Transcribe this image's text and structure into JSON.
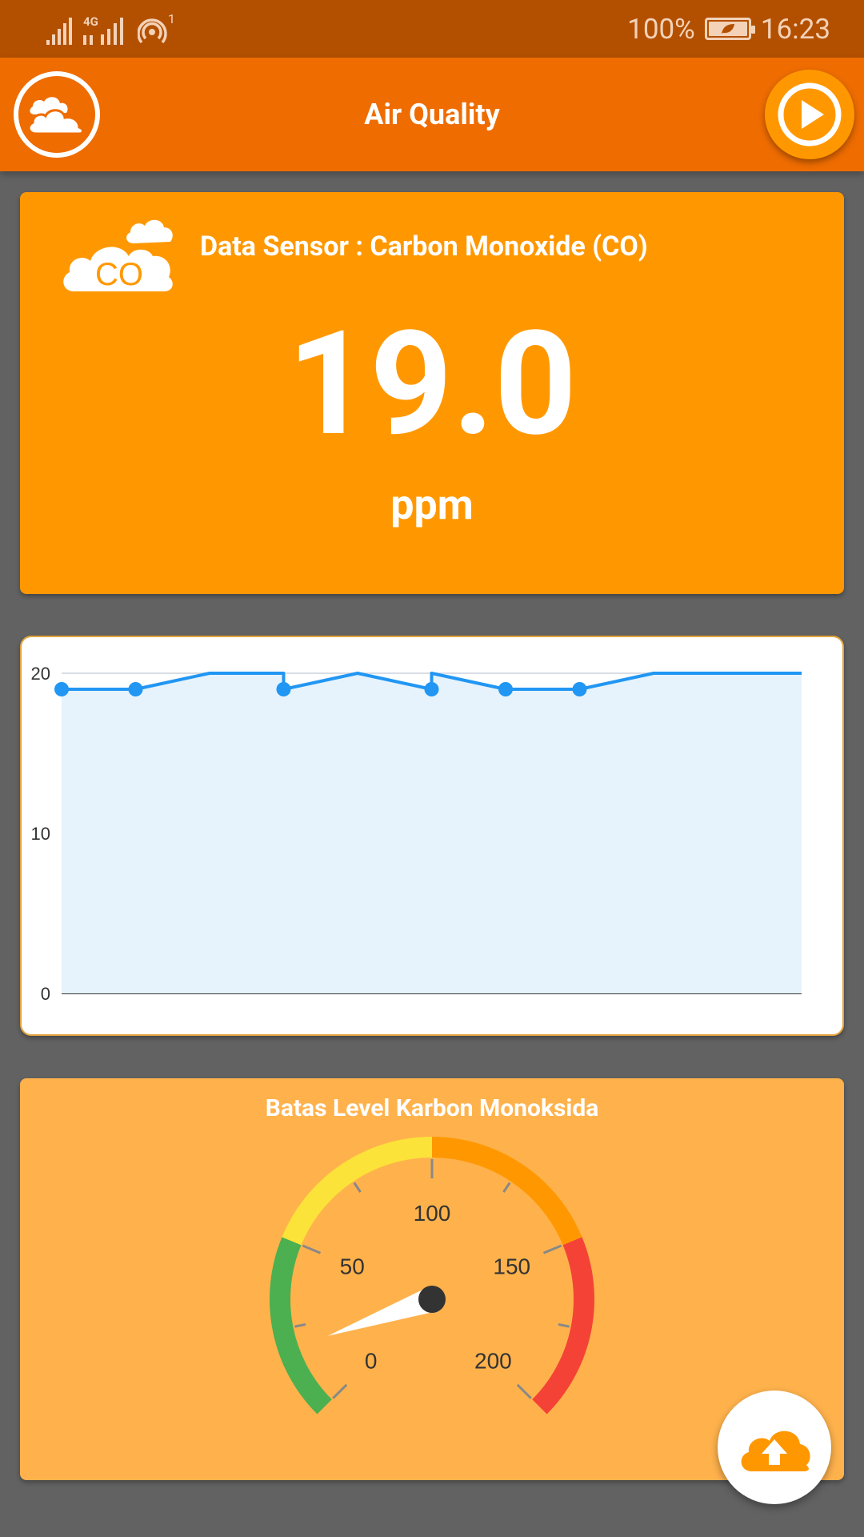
{
  "status_bar": {
    "network": "4G",
    "hotspot_count": "1",
    "battery": "100%",
    "time": "16:23"
  },
  "app_bar": {
    "title": "Air Quality",
    "left_icon": "cloud-icon",
    "right_icon": "play-icon"
  },
  "sensor": {
    "icon_text": "CO",
    "title": "Data Sensor : Carbon Monoxide (CO)",
    "value": "19.0",
    "unit": "ppm"
  },
  "chart_data": [
    {
      "type": "area",
      "title": "",
      "xlabel": "",
      "ylabel": "",
      "ylim": [
        0,
        20
      ],
      "yticks": [
        "0",
        "10",
        "20"
      ],
      "grid": true,
      "legend": "none",
      "color": "#2196F3",
      "fill": "#E6F3FC",
      "points": [
        {
          "x": 0,
          "y": 19,
          "marker": true
        },
        {
          "x": 1,
          "y": 19,
          "marker": true
        },
        {
          "x": 2,
          "y": 20,
          "marker": false
        },
        {
          "x": 3,
          "y": 20,
          "marker": false
        },
        {
          "x": 3,
          "y": 19,
          "marker": true
        },
        {
          "x": 4,
          "y": 20,
          "marker": false
        },
        {
          "x": 5,
          "y": 19,
          "marker": true
        },
        {
          "x": 5,
          "y": 20,
          "marker": false
        },
        {
          "x": 6,
          "y": 19,
          "marker": true
        },
        {
          "x": 7,
          "y": 19,
          "marker": true
        },
        {
          "x": 8,
          "y": 20,
          "marker": false
        },
        {
          "x": 9,
          "y": 20,
          "marker": false
        },
        {
          "x": 10,
          "y": 20,
          "marker": false
        }
      ]
    },
    {
      "type": "gauge",
      "title": "Batas Level Karbon Monoksida",
      "min": 0,
      "max": 200,
      "value": 19,
      "tick_labels": [
        "0",
        "50",
        "100",
        "150",
        "200"
      ],
      "bands": [
        {
          "from": 0,
          "to": 50,
          "color": "#4CAF50"
        },
        {
          "from": 50,
          "to": 100,
          "color": "#FBE339"
        },
        {
          "from": 100,
          "to": 150,
          "color": "#FF9800"
        },
        {
          "from": 150,
          "to": 200,
          "color": "#F44336"
        }
      ]
    }
  ],
  "fab": {
    "icon": "cloud-upload-icon"
  }
}
